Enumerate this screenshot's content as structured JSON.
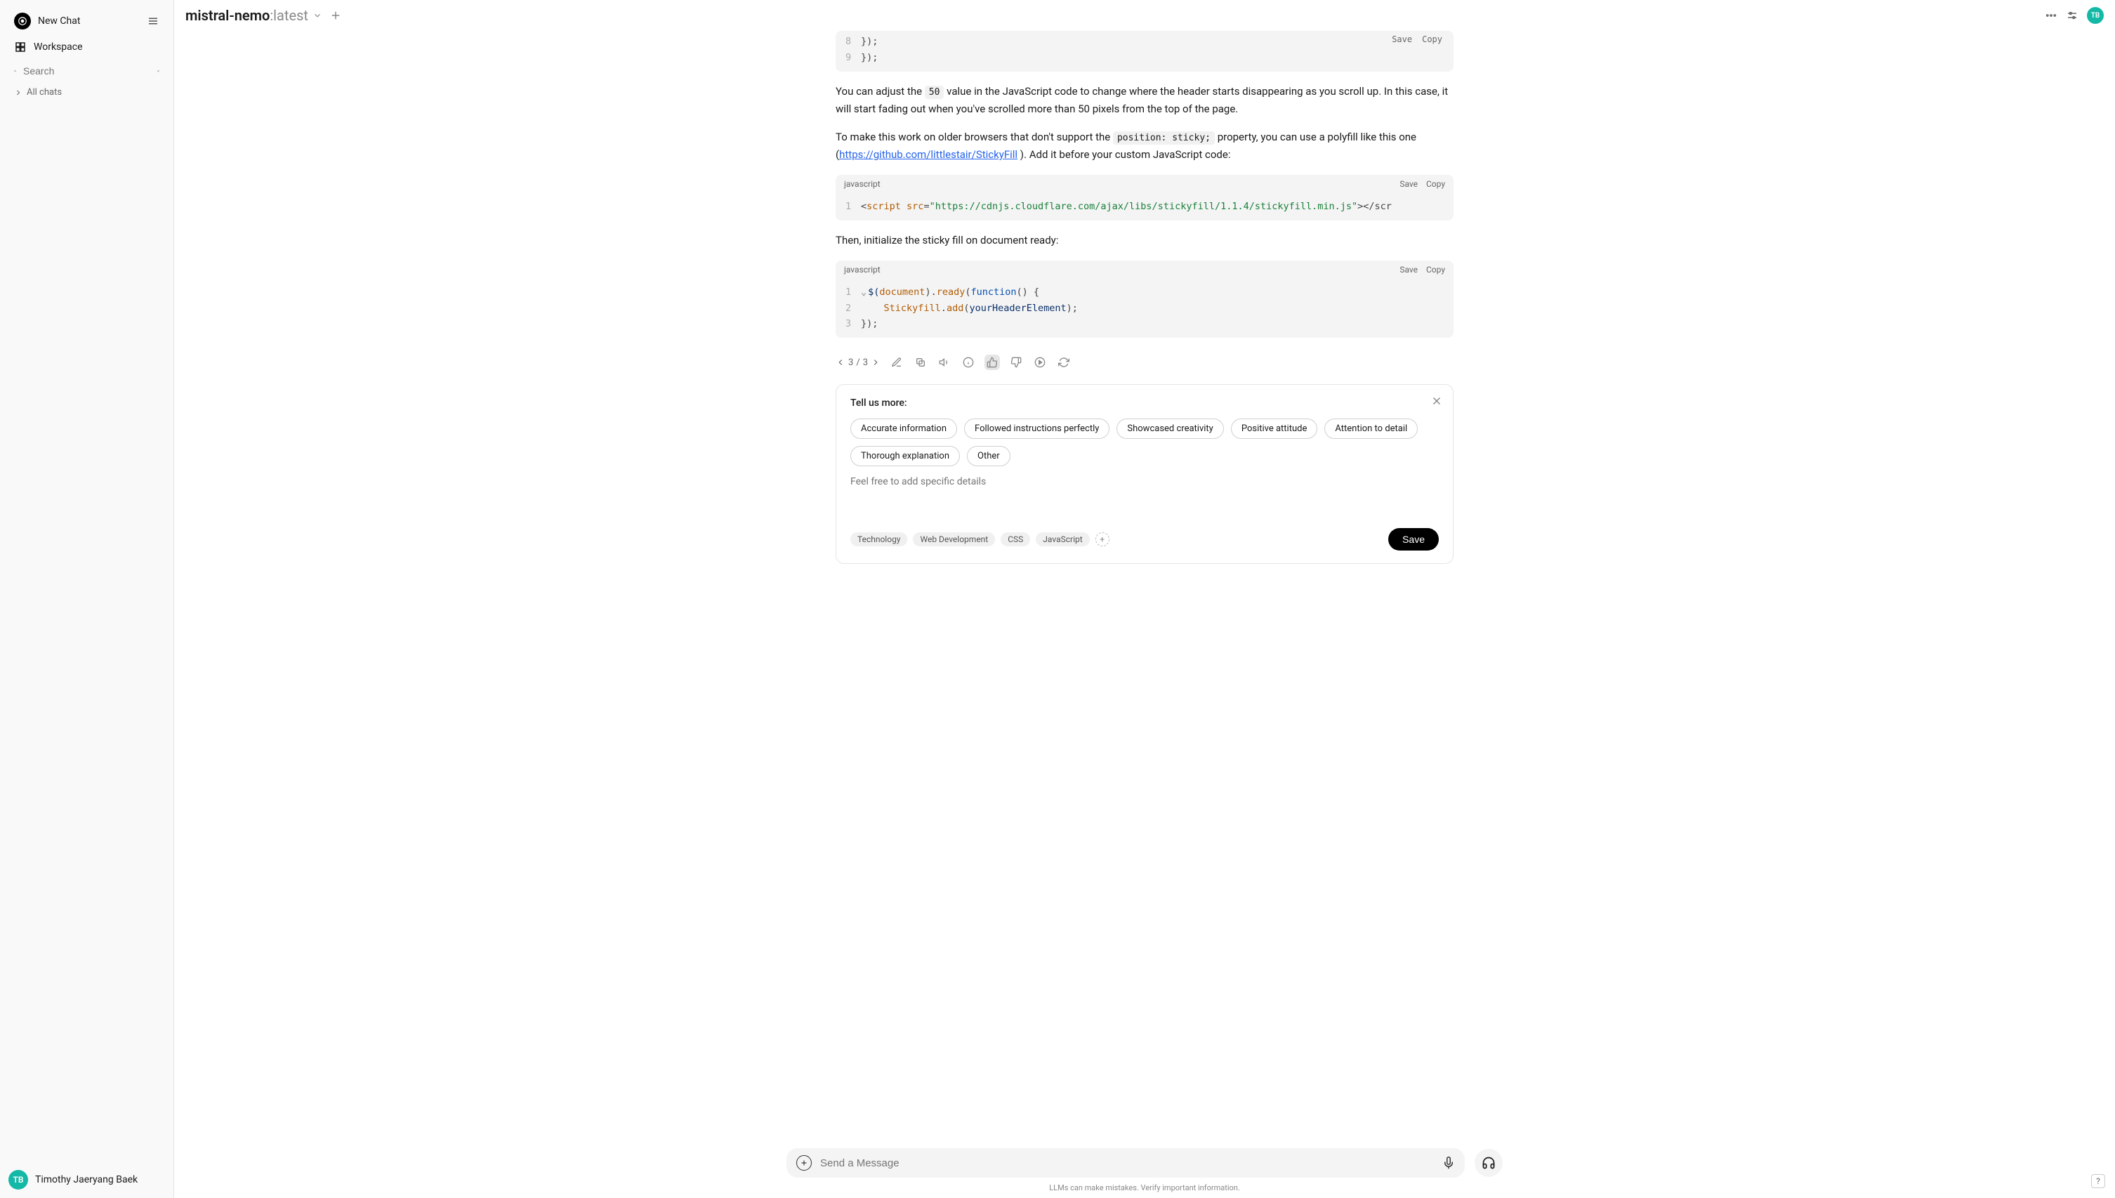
{
  "sidebar": {
    "new_chat": "New Chat",
    "workspace": "Workspace",
    "search_placeholder": "Search",
    "all_chats": "All chats",
    "user_name": "Timothy Jaeryang Baek",
    "user_initials": "TB"
  },
  "topbar": {
    "model_base": "mistral-nemo",
    "model_suffix": ":latest",
    "user_initials": "TB"
  },
  "code_block_1": {
    "lang": "",
    "save": "Save",
    "copy": "Copy",
    "lines": [
      {
        "n": "8",
        "text": "    });"
      },
      {
        "n": "9",
        "text": "});"
      }
    ]
  },
  "prose_1_a": "You can adjust the ",
  "prose_1_code": "50",
  "prose_1_b": " value in the JavaScript code to change where the header starts disappearing as you scroll up. In this case, it will start fading out when you've scrolled more than 50 pixels from the top of the page.",
  "prose_2_a": "To make this work on older browsers that don't support the ",
  "prose_2_code": "position: sticky;",
  "prose_2_b": " property, you can use a polyfill like this one (",
  "prose_2_link": "https://github.com/littlestair/StickyFill",
  "prose_2_c": " ). Add it before your custom JavaScript code:",
  "code_block_2": {
    "lang": "javascript",
    "save": "Save",
    "copy": "Copy",
    "line_n": "1",
    "lt": "<",
    "tag": "script",
    "src_attr": " src",
    "eq": "=",
    "src_val": "\"https://cdnjs.cloudflare.com/ajax/libs/stickyfill/1.1.4/stickyfill.min.js\"",
    "gt_close": "></scr"
  },
  "prose_3": "Then, initialize the sticky fill on document ready:",
  "code_block_3": {
    "lang": "javascript",
    "save": "Save",
    "copy": "Copy",
    "l1": {
      "n": "1",
      "dollar": "$(",
      "doc": "document",
      "ready": ").",
      "ready_fn": "ready",
      "open": "(",
      "func": "function",
      "paren": "()",
      "brace": " {"
    },
    "l2": {
      "n": "2",
      "indent": "    ",
      "sf": "Stickyfill",
      "add": ".",
      "add_fn": "add",
      "open": "(",
      "arg": "yourHeaderElement",
      "close": ");"
    },
    "l3": {
      "n": "3",
      "text": "});"
    }
  },
  "pager": {
    "current": "3",
    "sep": "/",
    "total": "3"
  },
  "feedback": {
    "title": "Tell us more:",
    "chips": [
      "Accurate information",
      "Followed instructions perfectly",
      "Showcased creativity",
      "Positive attitude",
      "Attention to detail",
      "Thorough explanation",
      "Other"
    ],
    "placeholder": "Feel free to add specific details",
    "tags": [
      "Technology",
      "Web Development",
      "CSS",
      "JavaScript"
    ],
    "save": "Save"
  },
  "composer": {
    "placeholder": "Send a Message"
  },
  "disclaimer": "LLMs can make mistakes. Verify important information.",
  "help": "?"
}
